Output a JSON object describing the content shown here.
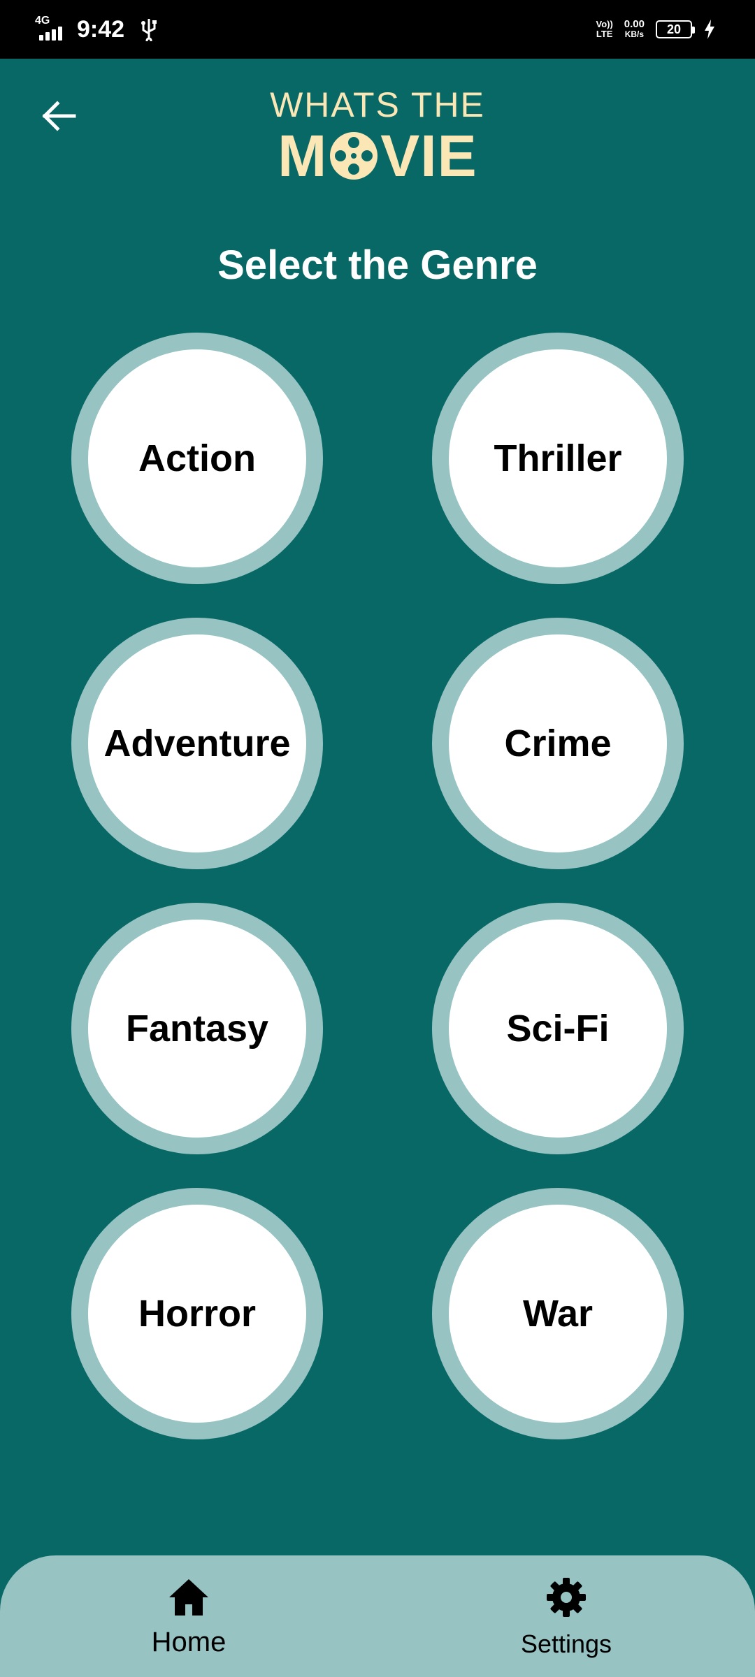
{
  "status_bar": {
    "network": "4G",
    "time": "9:42",
    "volte_top": "Vo))",
    "volte_bottom": "LTE",
    "speed_value": "0.00",
    "speed_unit": "KB/s",
    "battery": "20"
  },
  "header": {
    "logo_top": "WHATS THE",
    "logo_left": "M",
    "logo_right": "VIE"
  },
  "title": "Select the Genre",
  "genres": [
    {
      "label": "Action"
    },
    {
      "label": "Thriller"
    },
    {
      "label": "Adventure"
    },
    {
      "label": "Crime"
    },
    {
      "label": "Fantasy"
    },
    {
      "label": "Sci-Fi"
    },
    {
      "label": "Horror"
    },
    {
      "label": "War"
    }
  ],
  "nav": {
    "home_label": "Home",
    "settings_label": "Settings"
  },
  "icons": {
    "back": "arrow-left-icon",
    "home": "home-icon",
    "settings": "gear-icon",
    "logo_reel": "film-reel-icon"
  },
  "colors": {
    "background": "#076866",
    "circle_ring": "#97c3c3",
    "logo": "#fbe6b5",
    "nav_bar": "#97c3c3"
  }
}
